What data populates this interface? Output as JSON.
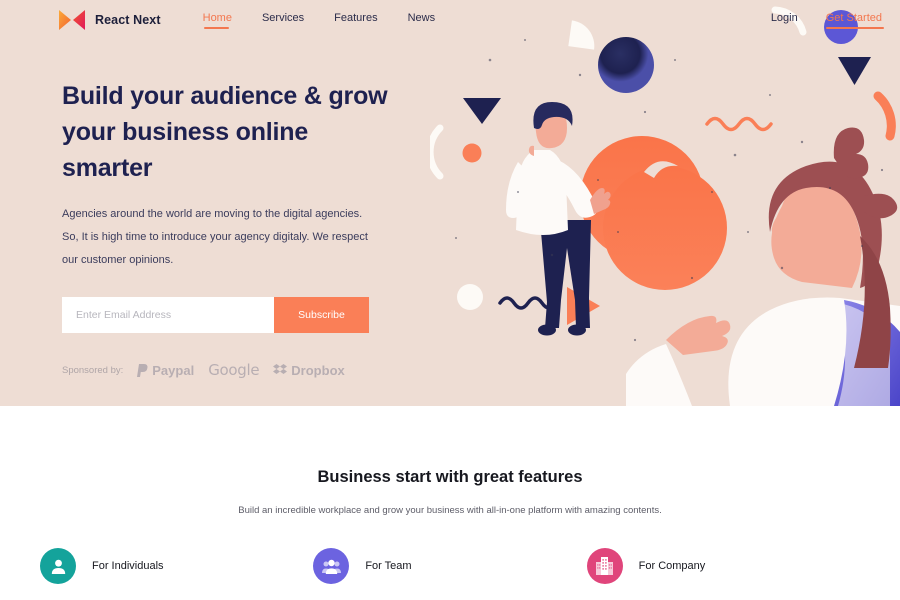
{
  "colors": {
    "hero_bg": "#eeddd4",
    "accent_orange": "#fa7f57",
    "nav_accent": "#f3774f",
    "navy": "#1e2150",
    "teal": "#14a39b",
    "purple": "#6c63e0",
    "pink": "#e0457b",
    "white": "#ffffff"
  },
  "nav": {
    "brand": "React Next",
    "brand_logo_icon": "m-logo-icon",
    "links": [
      {
        "label": "Home",
        "active": true
      },
      {
        "label": "Services",
        "active": false
      },
      {
        "label": "Features",
        "active": false
      },
      {
        "label": "News",
        "active": false
      }
    ],
    "login_label": "Login",
    "get_started_label": "Get Started"
  },
  "hero": {
    "headline_line1": "Build your audience & grow",
    "headline_line2": "your business online smarter",
    "subcopy": "Agencies around the world are moving to the digital agencies. So, It is high time to introduce your agency digitaly. We respect our customer opinions.",
    "email_placeholder": "Enter Email Address",
    "email_value": "",
    "subscribe_label": "Subscribe",
    "sponsored_label": "Sponsored by:",
    "sponsors": [
      {
        "name": "Paypal",
        "icon": "paypal-icon"
      },
      {
        "name": "Google",
        "icon": "google-wordmark-icon"
      },
      {
        "name": "Dropbox",
        "icon": "dropbox-icon"
      }
    ],
    "illustration": {
      "name": "people-with-shapes-illustration",
      "figures": [
        "man-reaching-figure",
        "woman-profile-figure"
      ],
      "shapes": [
        "navy-sphere",
        "coral-circle",
        "navy-triangle",
        "purple-circle",
        "orange-arc",
        "orange-squiggle",
        "navy-squiggle",
        "white-circle",
        "orange-dot",
        "orange-triangle",
        "white-arc"
      ]
    }
  },
  "features": {
    "title": "Business start with great features",
    "subtitle": "Build an incredible workplace and grow your business with all-in-one platform with amazing contents.",
    "cards": [
      {
        "title": "For Individuals",
        "icon": "person-icon",
        "color": "#14a39b"
      },
      {
        "title": "For Team",
        "icon": "people-group-icon",
        "color": "#6c63e0"
      },
      {
        "title": "For Company",
        "icon": "building-icon",
        "color": "#e0457b"
      }
    ]
  }
}
